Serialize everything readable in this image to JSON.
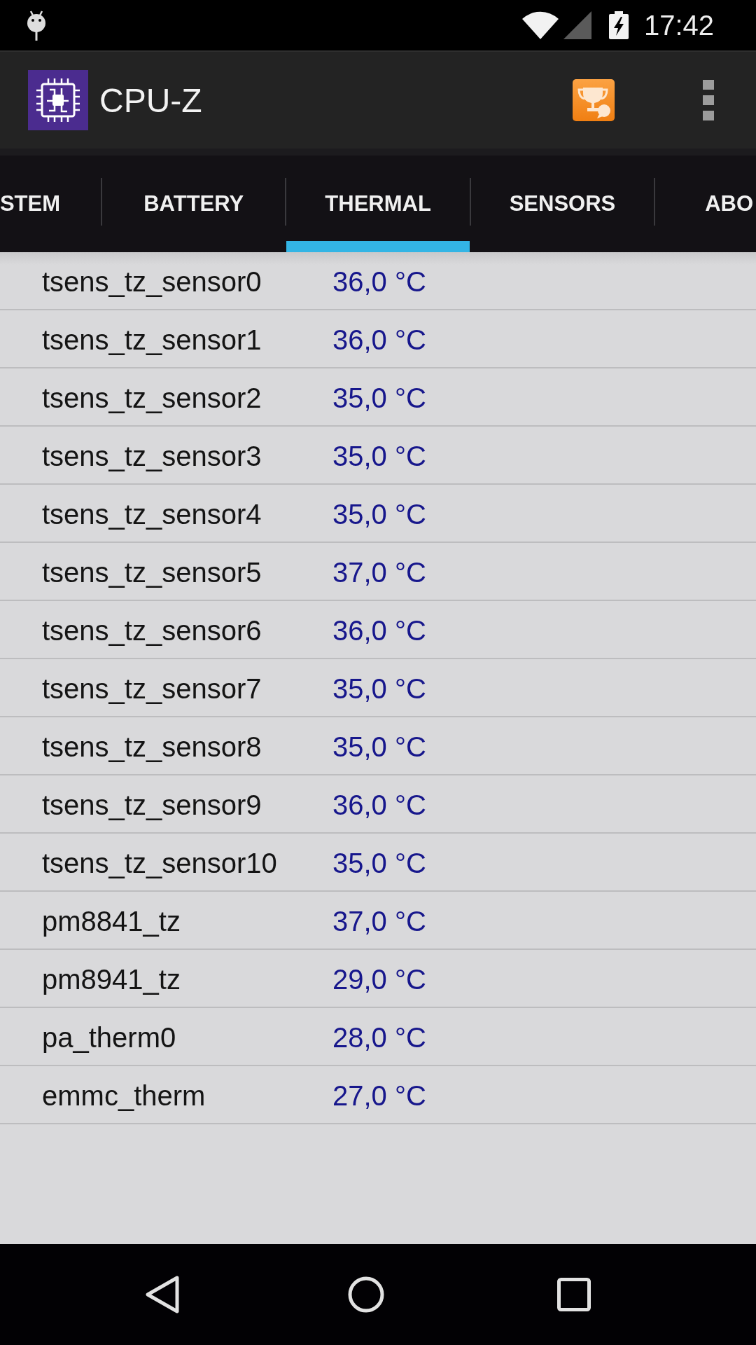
{
  "status_bar": {
    "time": "17:42"
  },
  "app_bar": {
    "title": "CPU-Z"
  },
  "tabs": [
    {
      "label": "STEM",
      "selected": false
    },
    {
      "label": "BATTERY",
      "selected": false
    },
    {
      "label": "THERMAL",
      "selected": true
    },
    {
      "label": "SENSORS",
      "selected": false
    },
    {
      "label": "ABO",
      "selected": false
    }
  ],
  "sensors": [
    {
      "name": "tsens_tz_sensor0",
      "value": "36,0 °C"
    },
    {
      "name": "tsens_tz_sensor1",
      "value": "36,0 °C"
    },
    {
      "name": "tsens_tz_sensor2",
      "value": "35,0 °C"
    },
    {
      "name": "tsens_tz_sensor3",
      "value": "35,0 °C"
    },
    {
      "name": "tsens_tz_sensor4",
      "value": "35,0 °C"
    },
    {
      "name": "tsens_tz_sensor5",
      "value": "37,0 °C"
    },
    {
      "name": "tsens_tz_sensor6",
      "value": "36,0 °C"
    },
    {
      "name": "tsens_tz_sensor7",
      "value": "35,0 °C"
    },
    {
      "name": "tsens_tz_sensor8",
      "value": "35,0 °C"
    },
    {
      "name": "tsens_tz_sensor9",
      "value": "36,0 °C"
    },
    {
      "name": "tsens_tz_sensor10",
      "value": "35,0 °C"
    },
    {
      "name": "pm8841_tz",
      "value": "37,0 °C"
    },
    {
      "name": "pm8941_tz",
      "value": "29,0 °C"
    },
    {
      "name": "pa_therm0",
      "value": "28,0 °C"
    },
    {
      "name": "emmc_therm",
      "value": "27,0 °C"
    }
  ]
}
